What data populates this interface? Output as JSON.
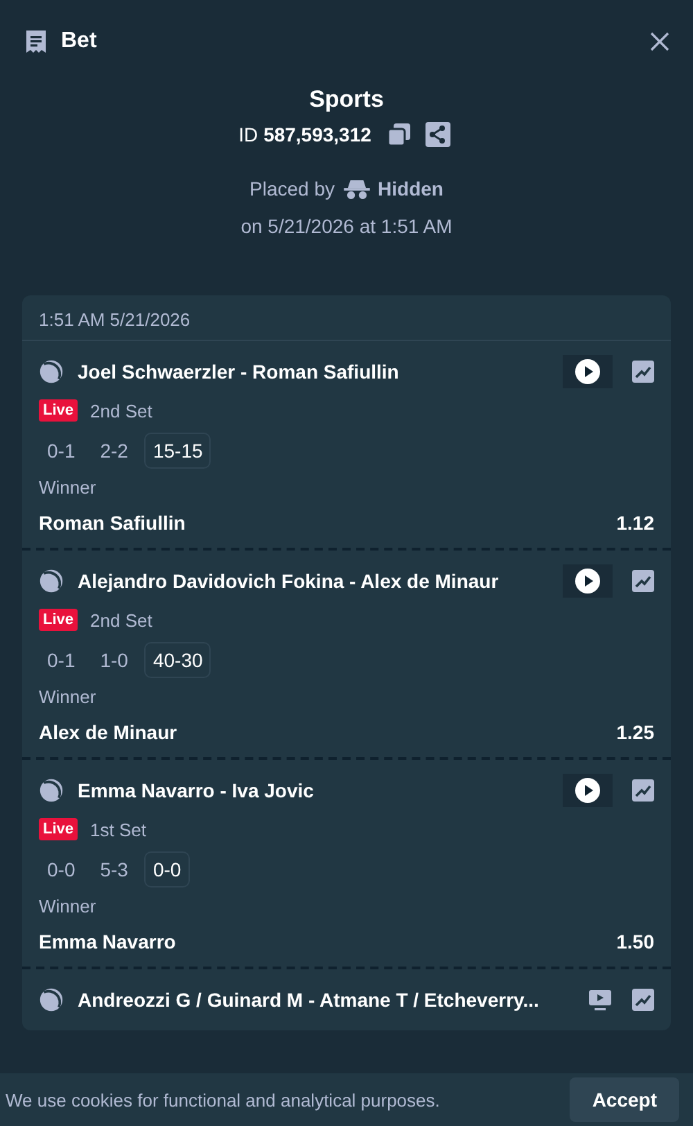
{
  "header": {
    "title": "Bet"
  },
  "summary": {
    "title": "Sports",
    "id_label": "ID",
    "id_value": "587,593,312",
    "placed_by_label": "Placed by",
    "placed_by_user": "Hidden",
    "placed_on": "on 5/21/2026 at 1:51 AM"
  },
  "slip": {
    "timestamp": "1:51 AM 5/21/2026",
    "events": [
      {
        "title": "Joel Schwaerzler - Roman Safiullin",
        "kind": "play",
        "status": "Live",
        "period": "2nd Set",
        "scores": [
          {
            "text": "0-1",
            "highlighted": false
          },
          {
            "text": "2-2",
            "highlighted": false
          },
          {
            "text": "15-15",
            "highlighted": true
          }
        ],
        "market": "Winner",
        "selection": "Roman Safiullin",
        "odds": "1.12"
      },
      {
        "title": "Alejandro Davidovich Fokina - Alex de Minaur",
        "kind": "play",
        "status": "Live",
        "period": "2nd Set",
        "scores": [
          {
            "text": "0-1",
            "highlighted": false
          },
          {
            "text": "1-0",
            "highlighted": false
          },
          {
            "text": "40-30",
            "highlighted": true
          }
        ],
        "market": "Winner",
        "selection": "Alex de Minaur",
        "odds": "1.25"
      },
      {
        "title": "Emma Navarro - Iva Jovic",
        "kind": "play",
        "status": "Live",
        "period": "1st Set",
        "scores": [
          {
            "text": "0-0",
            "highlighted": false
          },
          {
            "text": "5-3",
            "highlighted": false
          },
          {
            "text": "0-0",
            "highlighted": true
          }
        ],
        "market": "Winner",
        "selection": "Emma Navarro",
        "odds": "1.50"
      },
      {
        "title": "Andreozzi G / Guinard M - Atmane T / Etcheverry...",
        "kind": "tv"
      }
    ]
  },
  "cookie_banner": {
    "text": "We use cookies for functional and analytical purposes.",
    "button": "Accept"
  }
}
